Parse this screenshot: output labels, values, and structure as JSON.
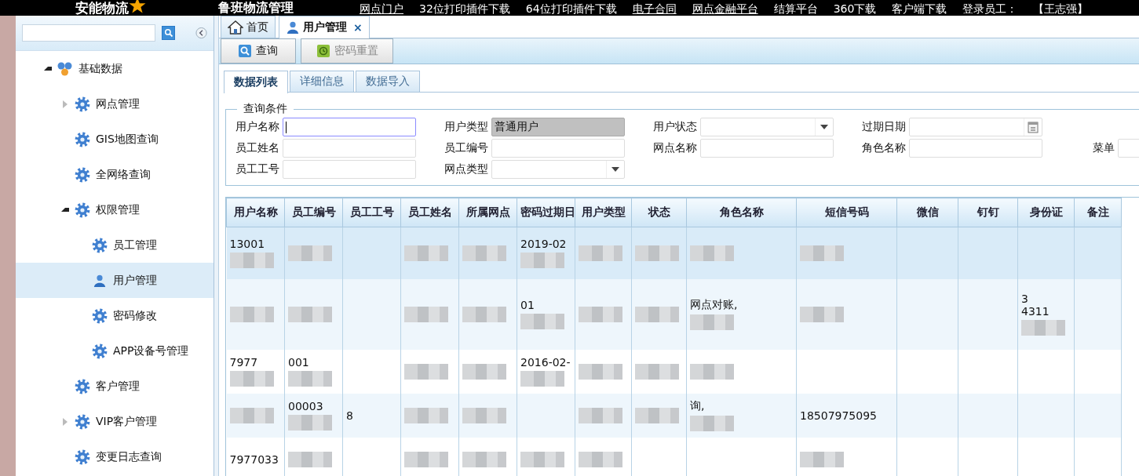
{
  "header": {
    "logo": "安能物流",
    "title": "鲁班物流管理",
    "links": [
      {
        "label": "网点门户",
        "underlined": true
      },
      {
        "label": "32位打印插件下载",
        "underlined": false
      },
      {
        "label": "64位打印插件下载",
        "underlined": false
      },
      {
        "label": "电子合同",
        "underlined": true
      },
      {
        "label": "网点金融平台",
        "underlined": true
      },
      {
        "label": "结算平台",
        "underlined": false
      },
      {
        "label": "360下载",
        "underlined": false
      },
      {
        "label": "客户端下载",
        "underlined": false
      }
    ],
    "user_label": "登录员工：",
    "user_name": "【王志强】"
  },
  "sidebar": {
    "tree": [
      {
        "label": "基础数据",
        "kind": "group",
        "expanded": true,
        "selected": false,
        "children": [
          {
            "label": "网点管理",
            "kind": "gear",
            "expanded": false,
            "selected": false
          },
          {
            "label": "GIS地图查询",
            "kind": "gear",
            "selected": false
          },
          {
            "label": "全网络查询",
            "kind": "gear",
            "selected": false
          },
          {
            "label": "权限管理",
            "kind": "gear",
            "expanded": true,
            "selected": false,
            "children": [
              {
                "label": "员工管理",
                "kind": "gear",
                "selected": false
              },
              {
                "label": "用户管理",
                "kind": "user",
                "selected": true
              },
              {
                "label": "密码修改",
                "kind": "gear",
                "selected": false
              },
              {
                "label": "APP设备号管理",
                "kind": "gear",
                "selected": false
              }
            ]
          },
          {
            "label": "客户管理",
            "kind": "gear",
            "selected": false
          },
          {
            "label": "VIP客户管理",
            "kind": "gear",
            "expanded": false,
            "selected": false
          },
          {
            "label": "变更日志查询",
            "kind": "gear",
            "selected": false
          }
        ]
      }
    ]
  },
  "tabs": [
    {
      "label": "首页",
      "kind": "home",
      "selected": false
    },
    {
      "label": "用户管理",
      "kind": "user",
      "selected": true,
      "close": "×"
    }
  ],
  "toolbar": [
    {
      "label": "查询",
      "kind": "search",
      "disabled": false
    },
    {
      "label": "密码重置",
      "kind": "reset",
      "disabled": true
    }
  ],
  "subtabs": [
    {
      "label": "数据列表",
      "selected": true
    },
    {
      "label": "详细信息",
      "selected": false
    },
    {
      "label": "数据导入",
      "selected": false
    }
  ],
  "query": {
    "legend": "查询条件",
    "rows": [
      [
        {
          "label": "用户名称",
          "kind": "text",
          "focused": true
        },
        {
          "label": "用户类型",
          "kind": "text",
          "value": "普通用户",
          "disabled": true
        },
        {
          "label": "用户状态",
          "kind": "select"
        },
        {
          "label": "过期日期",
          "kind": "date"
        }
      ],
      [
        {
          "label": "员工姓名",
          "kind": "text"
        },
        {
          "label": "员工编号",
          "kind": "text"
        },
        {
          "label": "网点名称",
          "kind": "text"
        },
        {
          "label": "角色名称",
          "kind": "text"
        },
        {
          "label": "菜单",
          "kind": "text"
        }
      ],
      [
        {
          "label": "员工工号",
          "kind": "text"
        },
        {
          "label": "网点类型",
          "kind": "select"
        }
      ]
    ]
  },
  "table": {
    "columns": [
      "用户名称",
      "员工编号",
      "员工工号",
      "员工姓名",
      "所属网点",
      "密码过期日",
      "用户类型",
      "状态",
      "角色名称",
      "短信号码",
      "微信",
      "钉钉",
      "身份证",
      "备注"
    ],
    "rows": [
      {
        "selected": true,
        "cells": [
          {
            "text": "13001",
            "blurred": true
          },
          {
            "blurred": true
          },
          {},
          {
            "blurred": true
          },
          {
            "blurred": true
          },
          {
            "text": "2019-02",
            "blurred": true
          },
          {
            "blurred": true
          },
          {
            "blurred": true
          },
          {
            "blurred": true
          },
          {
            "blurred": true
          },
          {},
          {},
          {},
          {}
        ]
      },
      {
        "selected": false,
        "cells": [
          {
            "blurred": true
          },
          {
            "blurred": true
          },
          {},
          {
            "blurred": true
          },
          {
            "blurred": true
          },
          {
            "text": "01",
            "blurred": true
          },
          {
            "blurred": true
          },
          {
            "blurred": true
          },
          {
            "text": "网点对账,",
            "blurred": true
          },
          {
            "blurred": true
          },
          {},
          {},
          {
            "text": "3\n4311",
            "blurred": true
          },
          {}
        ]
      },
      {
        "selected": false,
        "cells": [
          {
            "text": "7977",
            "blurred": true
          },
          {
            "text": "001",
            "blurred": true
          },
          {},
          {
            "blurred": true
          },
          {
            "blurred": true
          },
          {
            "text": "2016-02-",
            "blurred": true
          },
          {
            "blurred": true
          },
          {
            "blurred": true
          },
          {
            "blurred": true
          },
          {},
          {},
          {},
          {},
          {}
        ]
      },
      {
        "selected": false,
        "cells": [
          {
            "blurred": true
          },
          {
            "text": "00003",
            "blurred": true
          },
          {
            "text": "8"
          },
          {
            "blurred": true
          },
          {
            "blurred": true
          },
          {},
          {
            "blurred": true
          },
          {
            "blurred": true
          },
          {
            "text": "询,",
            "blurred": true
          },
          {
            "text": "18507975095"
          },
          {},
          {},
          {},
          {}
        ]
      },
      {
        "selected": false,
        "cells": [
          {
            "text": "7977033"
          },
          {
            "blurred": true
          },
          {},
          {
            "blurred": true
          },
          {
            "blurred": true
          },
          {
            "blurred": true
          },
          {
            "blurred": true
          },
          {},
          {},
          {
            "blurred": true
          },
          {},
          {},
          {},
          {}
        ]
      }
    ]
  }
}
